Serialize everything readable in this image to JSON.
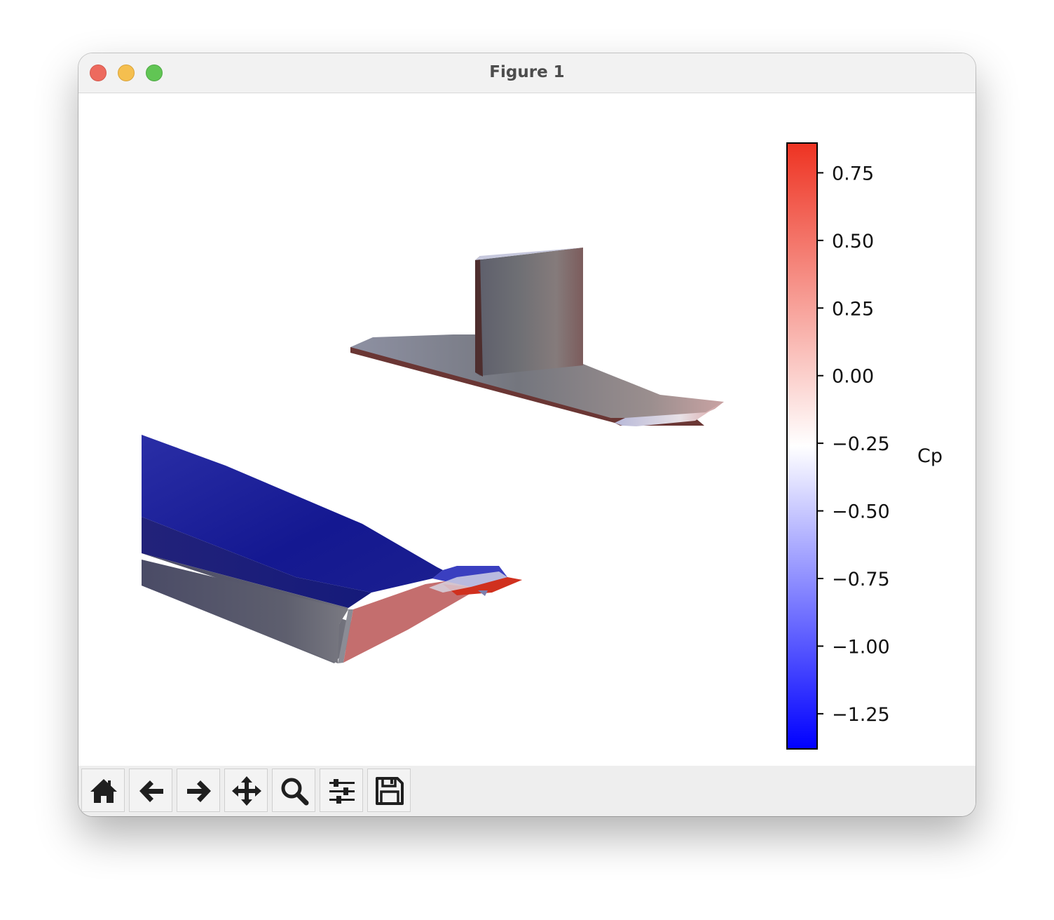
{
  "window": {
    "title": "Figure 1"
  },
  "toolbar": {
    "buttons": [
      {
        "name": "home-button",
        "icon": "home-icon"
      },
      {
        "name": "back-button",
        "icon": "arrow-left-icon"
      },
      {
        "name": "forward-button",
        "icon": "arrow-right-icon"
      },
      {
        "name": "pan-button",
        "icon": "move-icon"
      },
      {
        "name": "zoom-button",
        "icon": "magnifier-icon"
      },
      {
        "name": "configure-subplots-button",
        "icon": "sliders-icon"
      },
      {
        "name": "save-button",
        "icon": "floppy-disk-icon"
      }
    ]
  },
  "colorbar": {
    "label": "Cp",
    "colormap": "bwr",
    "vmin": -1.38,
    "vmax": 0.86,
    "ticks": [
      {
        "value": 0.75,
        "label": "0.75"
      },
      {
        "value": 0.5,
        "label": "0.50"
      },
      {
        "value": 0.25,
        "label": "0.25"
      },
      {
        "value": 0.0,
        "label": "0.00"
      },
      {
        "value": -0.25,
        "label": "−0.25"
      },
      {
        "value": -0.5,
        "label": "−0.50"
      },
      {
        "value": -0.75,
        "label": "−0.75"
      },
      {
        "value": -1.0,
        "label": "−1.00"
      },
      {
        "value": -1.25,
        "label": "−1.25"
      }
    ],
    "colors": {
      "low": "#0000ff",
      "mid": "#ffffff",
      "high": "#ee3322"
    }
  }
}
